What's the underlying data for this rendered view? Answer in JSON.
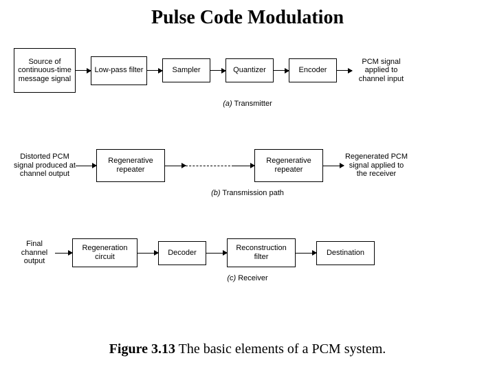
{
  "title": "Pulse Code Modulation",
  "caption_bold": "Figure 3.13",
  "caption_rest": " The basic elements of a PCM system.",
  "rows": {
    "a": {
      "source": "Source of continuous-time message signal",
      "b1": "Low-pass filter",
      "b2": "Sampler",
      "b3": "Quantizer",
      "b4": "Encoder",
      "out": "PCM signal applied to channel input",
      "sub_it": "(a)",
      "sub": " Transmitter"
    },
    "b": {
      "in": "Distorted PCM signal produced at channel output",
      "b1": "Regenerative repeater",
      "b2": "Regenerative repeater",
      "out": "Regenerated PCM signal applied to the receiver",
      "sub_it": "(b)",
      "sub": " Transmission path"
    },
    "c": {
      "in": "Final channel output",
      "b1": "Regeneration circuit",
      "b2": "Decoder",
      "b3": "Reconstruction filter",
      "b4": "Destination",
      "sub_it": "(c)",
      "sub": " Receiver"
    }
  }
}
